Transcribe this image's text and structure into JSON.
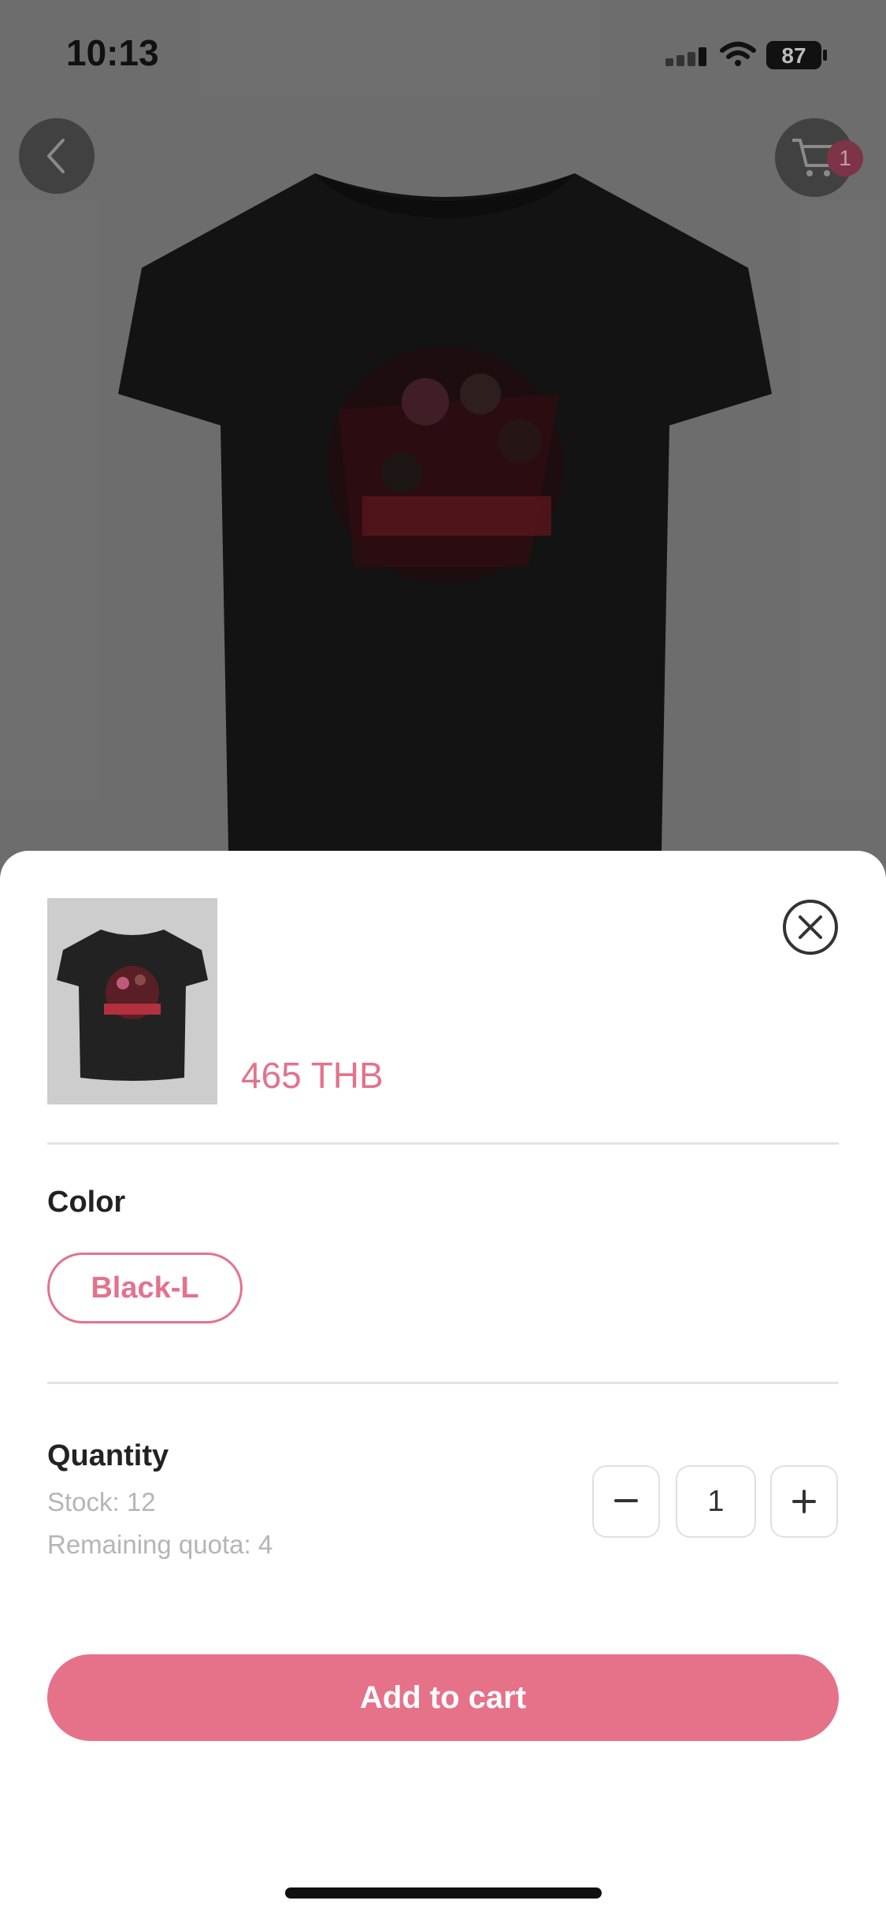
{
  "status_bar": {
    "time": "10:13",
    "battery": "87"
  },
  "header": {
    "cart_count": "1"
  },
  "sheet": {
    "price": "465 THB",
    "color_section_title": "Color",
    "selected_variant": "Black-L",
    "quantity_section_title": "Quantity",
    "stock_text": "Stock: 12",
    "quota_text": "Remaining quota: 4",
    "quantity_value": "1",
    "decrement_symbol": "−",
    "increment_symbol": "+",
    "add_to_cart_label": "Add to cart"
  },
  "icons": {
    "back": "chevron-left-icon",
    "cart": "cart-icon",
    "close": "close-icon",
    "signal": "signal-icon",
    "wifi": "wifi-icon",
    "battery": "battery-icon"
  },
  "colors": {
    "accent": "#e67289",
    "price": "#e4728c",
    "cart_badge": "#7d3446"
  }
}
